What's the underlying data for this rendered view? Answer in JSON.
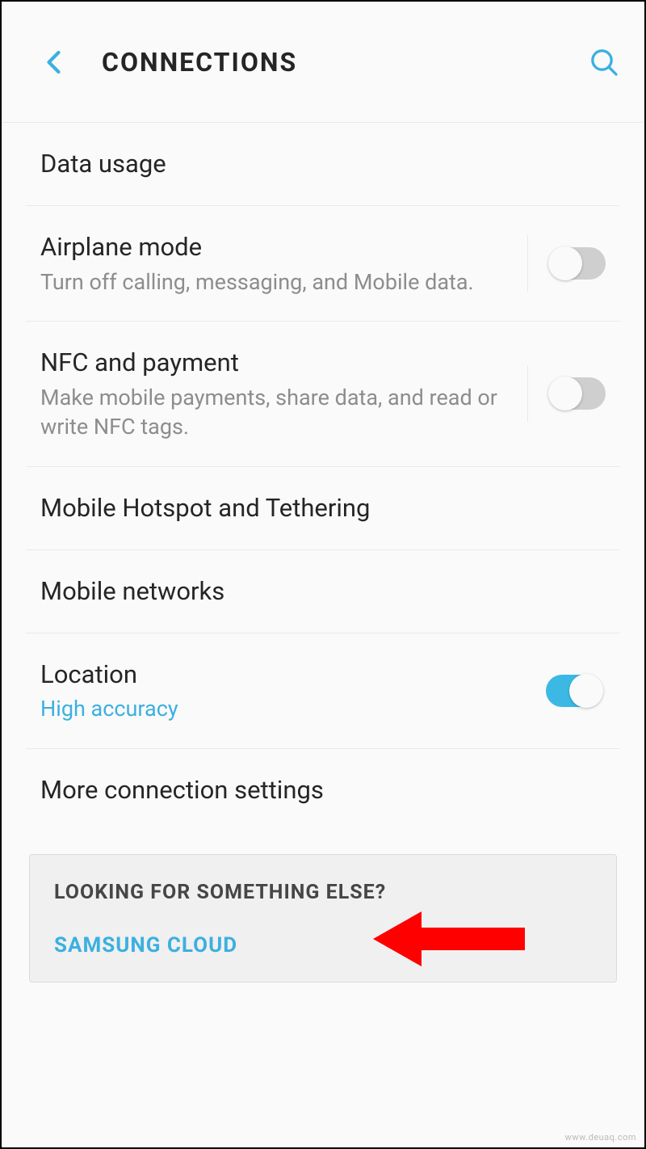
{
  "header": {
    "title": "CONNECTIONS"
  },
  "items": {
    "data_usage": {
      "title": "Data usage"
    },
    "airplane": {
      "title": "Airplane mode",
      "sub": "Turn off calling, messaging, and Mobile data."
    },
    "nfc": {
      "title": "NFC and payment",
      "sub": "Make mobile payments, share data, and read or write NFC tags."
    },
    "hotspot": {
      "title": "Mobile Hotspot and Tethering"
    },
    "mobile_networks": {
      "title": "Mobile networks"
    },
    "location": {
      "title": "Location",
      "sub": "High accuracy"
    },
    "more": {
      "title": "More connection settings"
    }
  },
  "footer": {
    "heading": "LOOKING FOR SOMETHING ELSE?",
    "link": "SAMSUNG CLOUD"
  },
  "watermark": "www.deuaq.com"
}
